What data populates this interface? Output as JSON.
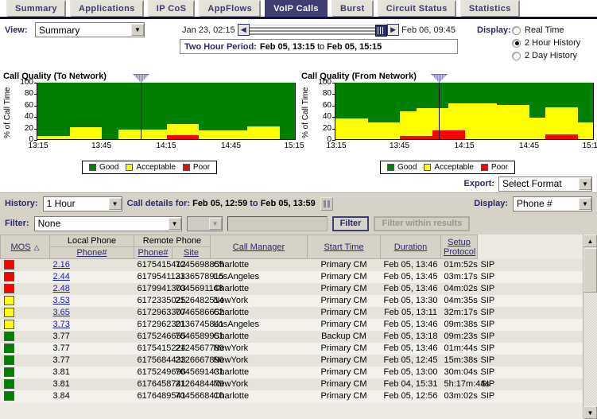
{
  "tabs": [
    {
      "label": "Summary",
      "active": false
    },
    {
      "label": "Applications",
      "active": false
    },
    {
      "label": "IP CoS",
      "active": false
    },
    {
      "label": "AppFlows",
      "active": false
    },
    {
      "label": "VoIP Calls",
      "active": true
    },
    {
      "label": "Burst",
      "active": false
    },
    {
      "label": "Circuit Status",
      "active": false
    },
    {
      "label": "Statistics",
      "active": false
    }
  ],
  "controls": {
    "view_label": "View:",
    "view_value": "Summary",
    "slider": {
      "start_date": "Jan 23, 02:15",
      "end_date": "Feb 06, 09:45",
      "prev_icon": "chevron-left-icon",
      "next_icon": "chevron-right-icon"
    },
    "period": {
      "key": "Two Hour Period:",
      "from": "Feb 05, 13:15",
      "to_word": "to",
      "to": "Feb 05, 15:15"
    },
    "display_label": "Display:",
    "display_options": [
      {
        "label": "Real Time",
        "selected": false
      },
      {
        "label": "2 Hour History",
        "selected": true
      },
      {
        "label": "2 Day History",
        "selected": false
      }
    ]
  },
  "chart_data": [
    {
      "type": "area",
      "id": "to-network",
      "title": "Call Quality (To Network)",
      "ylabel": "% of Call Time",
      "xlabel": "",
      "ylim": [
        0,
        100
      ],
      "yticks": [
        0,
        20,
        40,
        60,
        80,
        100
      ],
      "xticks": [
        "13:15",
        "13:45",
        "14:15",
        "14:45",
        "15:15"
      ],
      "legend": [
        "Good",
        "Acceptable",
        "Poor"
      ],
      "legend_position": "bottom",
      "colors": {
        "Good": "#008000",
        "Acceptable": "#ffff00",
        "Poor": "#ff0000"
      },
      "now_marker_pct": 40,
      "x": [
        "13:15",
        "13:23",
        "13:30",
        "13:38",
        "13:45",
        "13:53",
        "14:00",
        "14:08",
        "14:15",
        "14:23",
        "14:30",
        "14:38",
        "14:45",
        "14:53",
        "15:00",
        "15:08"
      ],
      "series": [
        {
          "name": "Poor",
          "values": [
            0,
            0,
            0,
            0,
            0,
            0,
            0,
            0,
            7,
            7,
            0,
            0,
            0,
            0,
            0,
            0
          ]
        },
        {
          "name": "Acceptable",
          "values": [
            6,
            6,
            21,
            21,
            0,
            17,
            17,
            17,
            20,
            20,
            16,
            16,
            16,
            22,
            22,
            0
          ]
        },
        {
          "name": "Good",
          "values": [
            94,
            94,
            79,
            79,
            100,
            83,
            83,
            83,
            73,
            73,
            84,
            84,
            84,
            78,
            78,
            100
          ]
        }
      ]
    },
    {
      "type": "area",
      "id": "from-network",
      "title": "Call Quality (From Network)",
      "ylabel": "% of Call Time",
      "xlabel": "",
      "ylim": [
        0,
        100
      ],
      "yticks": [
        0,
        20,
        40,
        60,
        80,
        100
      ],
      "xticks": [
        "13:15",
        "13:45",
        "14:15",
        "14:45",
        "15:15"
      ],
      "legend": [
        "Good",
        "Acceptable",
        "Poor"
      ],
      "legend_position": "bottom",
      "colors": {
        "Good": "#008000",
        "Acceptable": "#ffff00",
        "Poor": "#ff0000"
      },
      "now_marker_pct": 40,
      "x": [
        "13:15",
        "13:23",
        "13:30",
        "13:38",
        "13:45",
        "13:53",
        "14:00",
        "14:08",
        "14:15",
        "14:23",
        "14:30",
        "14:38",
        "14:45",
        "14:53",
        "15:00",
        "15:08"
      ],
      "series": [
        {
          "name": "Poor",
          "values": [
            0,
            0,
            0,
            0,
            5,
            5,
            15,
            15,
            0,
            0,
            0,
            0,
            0,
            8,
            8,
            0
          ]
        },
        {
          "name": "Acceptable",
          "values": [
            37,
            37,
            29,
            29,
            45,
            50,
            40,
            48,
            63,
            63,
            60,
            60,
            38,
            48,
            48,
            30
          ]
        },
        {
          "name": "Good",
          "values": [
            63,
            63,
            71,
            71,
            50,
            45,
            45,
            37,
            37,
            37,
            40,
            40,
            62,
            44,
            44,
            70
          ]
        }
      ]
    }
  ],
  "export": {
    "label": "Export:",
    "value": "Select Format"
  },
  "panel": {
    "history_label": "History:",
    "history_value": "1 Hour",
    "call_details_key": "Call details for:",
    "call_details_from": "Feb 05, 12:59",
    "call_details_to_word": "to",
    "call_details_to": "Feb 05, 13:59",
    "pause_icon": "pause-icon",
    "display_label": "Display:",
    "display_value": "Phone #",
    "filter_label": "Filter:",
    "filter_value": "None",
    "filter_op_value": "",
    "filter_text_value": "",
    "filter_button": "Filter",
    "filter_within_button": "Filter within results"
  },
  "table": {
    "group_headers": {
      "local": "Local Phone",
      "remote": "Remote Phone"
    },
    "headers": {
      "mos": "MOS",
      "mos_sort_icon": "sort-ascending-icon",
      "local_phone": "Phone#",
      "remote_phone": "Phone#",
      "site": "Site",
      "call_manager": "Call Manager",
      "start_time": "Start Time",
      "duration": "Duration",
      "setup_protocol_line1": "Setup",
      "setup_protocol_line2": "Protocol"
    },
    "rows": [
      {
        "color": "#ff0000",
        "mos": "2.16",
        "link": true,
        "local": "6175415412",
        "remote": "7045698855",
        "site": "Charlotte",
        "cm": "Primary CM",
        "start": "Feb 05, 13:46",
        "dur": "01m:52s",
        "proto": "SIP"
      },
      {
        "color": "#ff0000",
        "mos": "2.44",
        "link": true,
        "local": "6179541133",
        "remote": "2136578915",
        "site": "LosAngeles",
        "cm": "Primary CM",
        "start": "Feb 05, 13:45",
        "dur": "03m:17s",
        "proto": "SIP"
      },
      {
        "color": "#ff0000",
        "mos": "2.48",
        "link": true,
        "local": "6179941303",
        "remote": "7045691148",
        "site": "Charlotte",
        "cm": "Primary CM",
        "start": "Feb 05, 13:46",
        "dur": "04m:02s",
        "proto": "SIP"
      },
      {
        "color": "#ffff00",
        "mos": "3.53",
        "link": true,
        "local": "6172335025",
        "remote": "2126482514",
        "site": "NewYork",
        "cm": "Primary CM",
        "start": "Feb 05, 13:30",
        "dur": "04m:35s",
        "proto": "SIP"
      },
      {
        "color": "#ffff00",
        "mos": "3.65",
        "link": true,
        "local": "6172963307",
        "remote": "7046586652",
        "site": "Charlotte",
        "cm": "Primary CM",
        "start": "Feb 05, 13:11",
        "dur": "32m:17s",
        "proto": "SIP"
      },
      {
        "color": "#ffff00",
        "mos": "3.73",
        "link": true,
        "local": "6172962301",
        "remote": "2136745841",
        "site": "LosAngeles",
        "cm": "Primary CM",
        "start": "Feb 05, 13:46",
        "dur": "09m:38s",
        "proto": "SIP"
      },
      {
        "color": "#008000",
        "mos": "3.77",
        "link": false,
        "local": "6175246655",
        "remote": "7046589951",
        "site": "Charlotte",
        "cm": "Backup CM",
        "start": "Feb 05, 13:18",
        "dur": "09m:23s",
        "proto": "SIP"
      },
      {
        "color": "#008000",
        "mos": "3.77",
        "link": false,
        "local": "6175415224",
        "remote": "2124567789",
        "site": "NewYork",
        "cm": "Primary CM",
        "start": "Feb 05, 13:46",
        "dur": "01m:44s",
        "proto": "SIP"
      },
      {
        "color": "#008000",
        "mos": "3.77",
        "link": false,
        "local": "6175684433",
        "remote": "2126667890",
        "site": "NewYork",
        "cm": "Primary CM",
        "start": "Feb 05, 12:45",
        "dur": "15m:38s",
        "proto": "SIP"
      },
      {
        "color": "#008000",
        "mos": "3.81",
        "link": false,
        "local": "6175249696",
        "remote": "7045691431",
        "site": "Charlotte",
        "cm": "Primary CM",
        "start": "Feb 05, 13:00",
        "dur": "30m:04s",
        "proto": "SIP"
      },
      {
        "color": "#008000",
        "mos": "3.81",
        "link": false,
        "local": "6176458741",
        "remote": "2126484479",
        "site": "NewYork",
        "cm": "Primary CM",
        "start": "Feb 04, 15:31",
        "dur": "5h:17m:44s",
        "proto": "SIP"
      },
      {
        "color": "#008000",
        "mos": "3.84",
        "link": false,
        "local": "6176489541",
        "remote": "7045668410",
        "site": "Charlotte",
        "cm": "Primary CM",
        "start": "Feb 05, 12:56",
        "dur": "03m:02s",
        "proto": "SIP"
      }
    ]
  }
}
